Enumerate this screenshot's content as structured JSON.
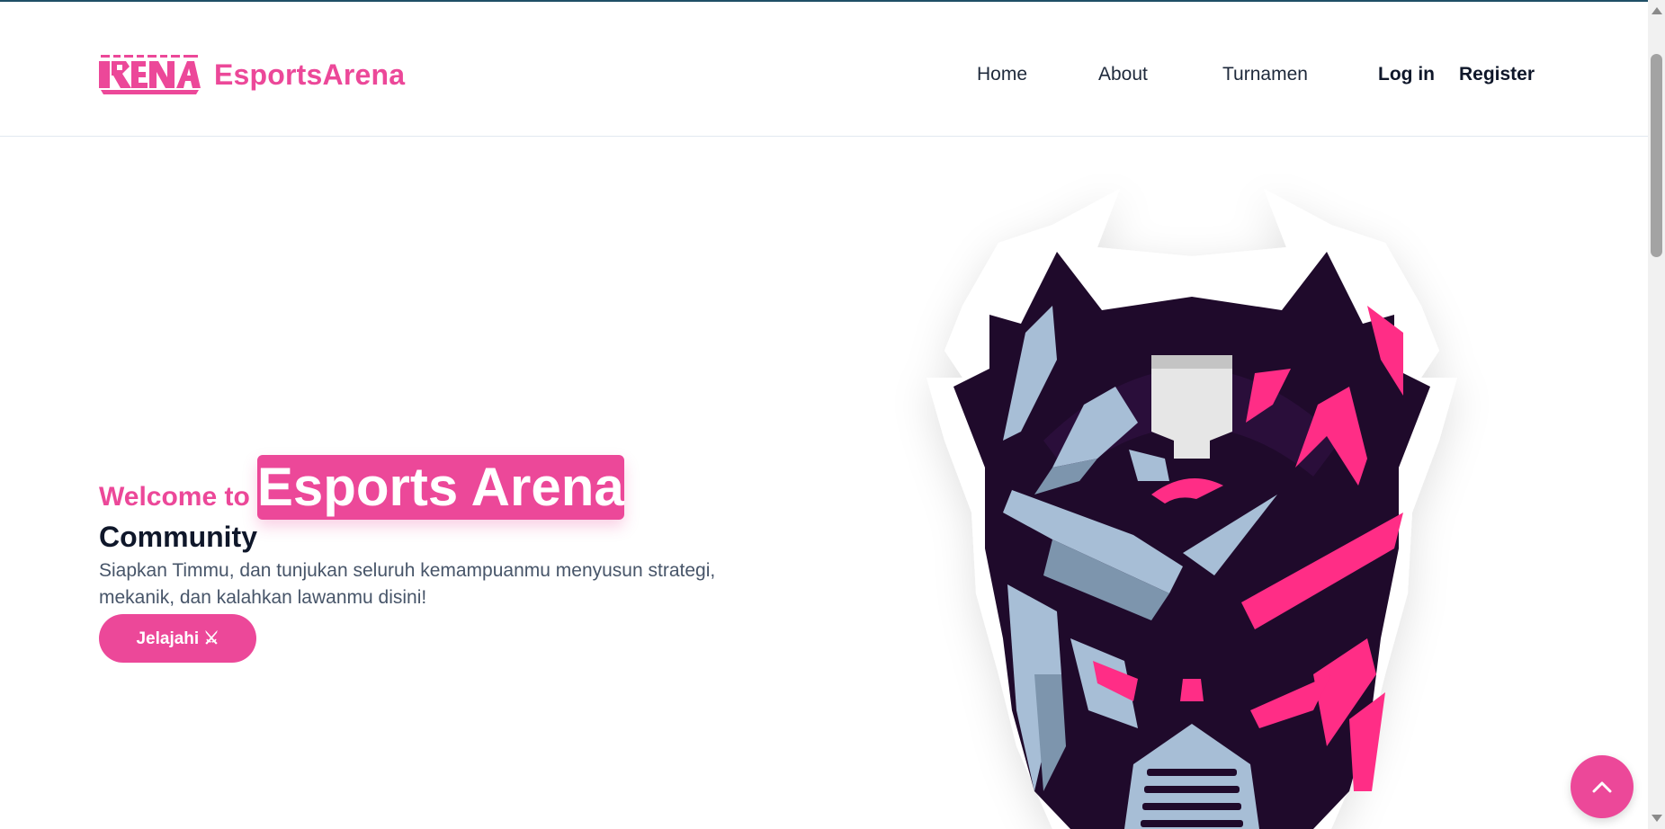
{
  "header": {
    "brand": "EsportsArena",
    "logo_icon": "arena-logo-icon",
    "nav": [
      {
        "label": "Home"
      },
      {
        "label": "About"
      },
      {
        "label": "Turnamen"
      }
    ],
    "login_label": "Log in",
    "register_label": "Register"
  },
  "hero": {
    "welcome": "Welcome to",
    "highlight": "Esports Arena",
    "subtitle": "Community",
    "description": "Siapkan Timmu, dan tunjukan seluruh kemampuanmu menyusun strategi, mekanik, dan kalahkan lawanmu disini!",
    "cta_label": "Jelajahi ⚔",
    "mascot_icon": "robot-mascot-icon"
  },
  "colors": {
    "accent": "#ec4899",
    "dark": "#1f0a2b",
    "steel": "#a7bed6"
  },
  "scroll_top_icon": "chevron-up-icon"
}
